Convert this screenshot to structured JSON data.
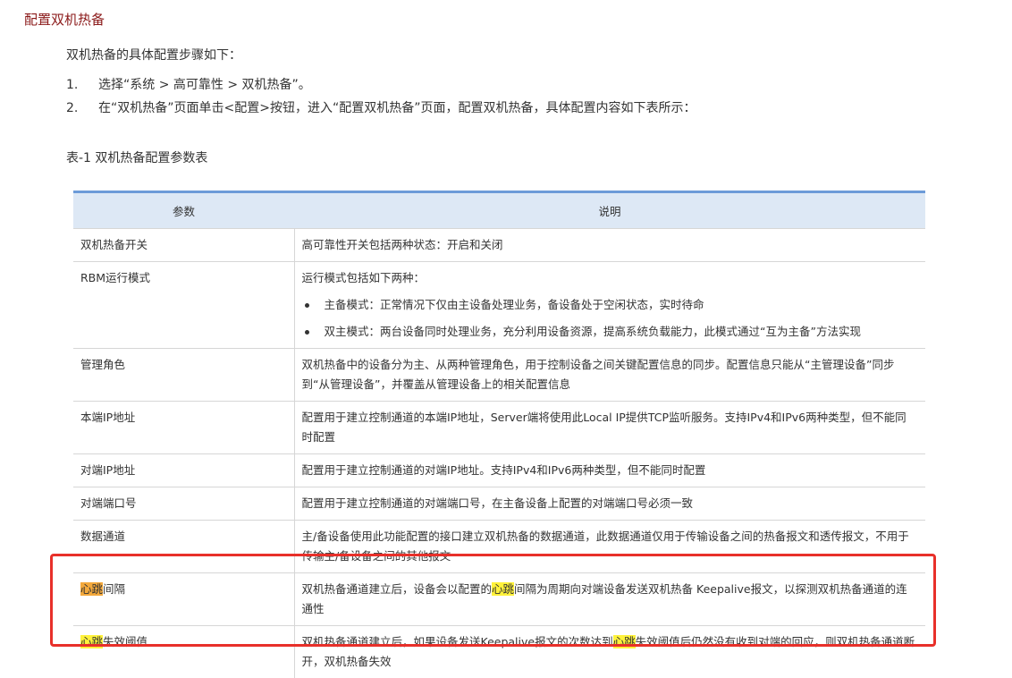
{
  "heading": "配置双机热备",
  "intro": "双机热备的具体配置步骤如下：",
  "steps": [
    {
      "num": "1.",
      "text": "选择“系统 > 高可靠性 > 双机热备”。"
    },
    {
      "num": "2.",
      "text": "在“双机热备”页面单击<配置>按钮，进入“配置双机热备”页面，配置双机热备，具体配置内容如下表所示："
    }
  ],
  "table_caption": "表-1 双机热备配置参数表",
  "table": {
    "headers": {
      "param": "参数",
      "desc": "说明"
    },
    "rows": [
      {
        "param": "双机热备开关",
        "desc": "高可靠性开关包括两种状态：开启和关闭"
      },
      {
        "param": "RBM运行模式",
        "desc": "运行模式包括如下两种：",
        "bullets": [
          "主备模式：正常情况下仅由主设备处理业务，备设备处于空闲状态，实时待命",
          "双主模式：两台设备同时处理业务，充分利用设备资源，提高系统负载能力，此模式通过“互为主备”方法实现"
        ]
      },
      {
        "param": "管理角色",
        "desc": "双机热备中的设备分为主、从两种管理角色，用于控制设备之间关键配置信息的同步。配置信息只能从“主管理设备”同步到“从管理设备”，并覆盖从管理设备上的相关配置信息"
      },
      {
        "param": "本端IP地址",
        "desc": "配置用于建立控制通道的本端IP地址，Server端将使用此Local IP提供TCP监听服务。支持IPv4和IPv6两种类型，但不能同时配置"
      },
      {
        "param": "对端IP地址",
        "desc": "配置用于建立控制通道的对端IP地址。支持IPv4和IPv6两种类型，但不能同时配置"
      },
      {
        "param": "对端端口号",
        "desc": "配置用于建立控制通道的对端端口号，在主备设备上配置的对端端口号必须一致"
      },
      {
        "param": "数据通道",
        "desc": "主/备设备使用此功能配置的接口建立双机热备的数据通道，此数据通道仅用于传输设备之间的热备报文和透传报文，不用于传输主/备设备之间的其他报文"
      },
      {
        "param_hl": "心跳",
        "param_rest": "间隔",
        "desc_before": "双机热备通道建立后，设备会以配置的",
        "desc_hl": "心跳",
        "desc_after": "间隔为周期向对端设备发送双机热备 Keepalive报文，以探测双机热备通道的连通性"
      },
      {
        "param_hl": "心跳",
        "param_rest": "失效阈值",
        "desc_before": "双机热备通道建立后，如果设备发送Keepalive报文的次数达到",
        "desc_hl": "心跳",
        "desc_after": "失效阈值后仍然没有收到对端的回应，则双机热备通道断开，双机热备失效"
      }
    ]
  },
  "colors": {
    "heading": "#8b1a1a",
    "table_header_bg": "#dde8f5",
    "table_header_border": "#6c9bd8",
    "highlight_orange": "#f4a93c",
    "highlight_yellow": "#fff23b",
    "annotation_box": "#e8302a"
  }
}
